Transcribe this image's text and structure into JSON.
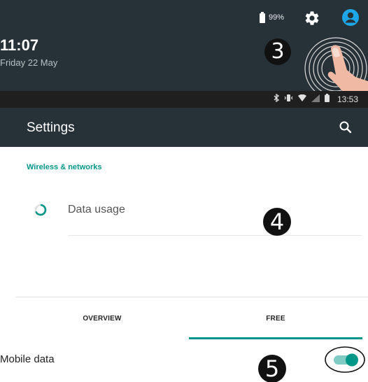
{
  "shade": {
    "battery_percent": "99%",
    "time": "11:07",
    "date": "Friday 22 May",
    "step_number": "3",
    "icons": [
      "battery-icon",
      "gear-icon",
      "account-icon",
      "tap-gesture-icon"
    ]
  },
  "status_bar": {
    "time": "13:53",
    "icons": [
      "bluetooth-icon",
      "vibrate-icon",
      "wifi-icon",
      "signal-icon",
      "battery-icon"
    ]
  },
  "app_bar": {
    "title": "Settings",
    "search_icon": "search-icon"
  },
  "settings_list": {
    "section_header": "Wireless & networks",
    "items": [
      {
        "label": "Data usage",
        "icon": "data-usage-icon"
      }
    ],
    "step_number": "4"
  },
  "data_usage_screen": {
    "tabs": [
      {
        "label": "OVERVIEW",
        "selected": false
      },
      {
        "label": "FREE",
        "selected": true
      }
    ],
    "mobile_data": {
      "label": "Mobile data",
      "enabled": true
    },
    "step_number": "5"
  },
  "colors": {
    "dark_bar": "#263238",
    "accent": "#009688",
    "account": "#1ea7e8"
  }
}
